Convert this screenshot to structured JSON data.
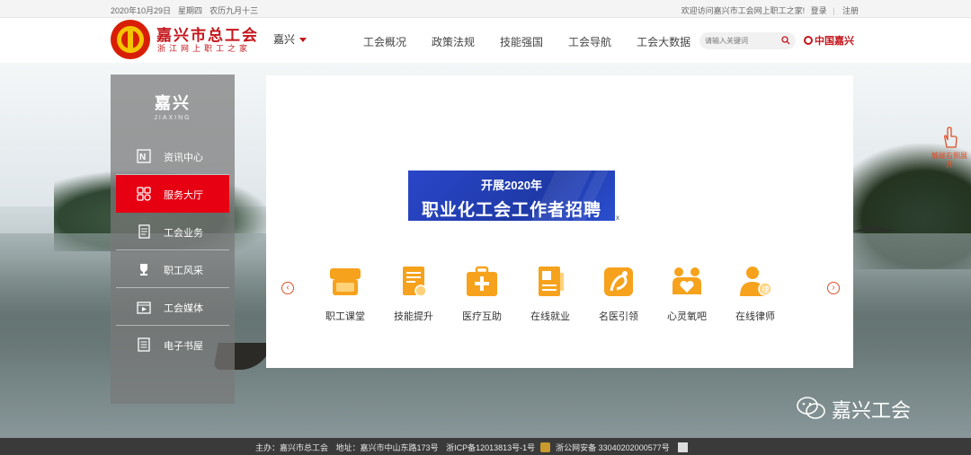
{
  "topbar": {
    "date": "2020年10月29日",
    "weekday": "星期四",
    "lunar": "农历九月十三",
    "welcome": "欢迎访问嘉兴市工会网上职工之家!",
    "login": "登录",
    "sep": "|",
    "register": "注册"
  },
  "header": {
    "title": "嘉兴市总工会",
    "subtitle": "浙江网上职工之家",
    "city": "嘉兴",
    "nav": [
      "工会概况",
      "政策法规",
      "技能强国",
      "工会导航",
      "工会大数据"
    ],
    "search_placeholder": "请输入关键词",
    "china_jiaxing": "中国嘉兴"
  },
  "sidebar": {
    "logo": "嘉兴",
    "logo_sub": "JIAXING",
    "items": [
      {
        "label": "资讯中心",
        "icon": "news-icon",
        "active": false
      },
      {
        "label": "服务大厅",
        "icon": "grid-icon",
        "active": true
      },
      {
        "label": "工会业务",
        "icon": "document-icon",
        "active": false
      },
      {
        "label": "职工风采",
        "icon": "trophy-icon",
        "active": false
      },
      {
        "label": "工会媒体",
        "icon": "media-icon",
        "active": false
      },
      {
        "label": "电子书屋",
        "icon": "book-icon",
        "active": false
      }
    ]
  },
  "banner": {
    "line1": "开展2020年",
    "line2": "职业化工会工作者招聘",
    "close": "x"
  },
  "services": [
    {
      "label": "职工课堂",
      "icon": "classroom-icon"
    },
    {
      "label": "技能提升",
      "icon": "certificate-icon"
    },
    {
      "label": "医疗互助",
      "icon": "medical-kit-icon"
    },
    {
      "label": "在线就业",
      "icon": "job-icon"
    },
    {
      "label": "名医引领",
      "icon": "doctor-icon"
    },
    {
      "label": "心灵氧吧",
      "icon": "heart-people-icon"
    },
    {
      "label": "在线律师",
      "icon": "lawyer-icon"
    }
  ],
  "carousel": {
    "prev": "‹",
    "next": "›"
  },
  "float_tip": "触碰右侧展开",
  "watermark": "嘉兴工会",
  "footer": {
    "host": "主办：嘉兴市总工会",
    "address": "地址：嘉兴市中山东路173号",
    "icp": "浙ICP备12013813号-1号",
    "police": "浙公网安备 33040202000577号"
  },
  "colors": {
    "brand_red": "#e60012",
    "service_orange": "#f6a21c",
    "banner_blue": "#2a46c8"
  }
}
